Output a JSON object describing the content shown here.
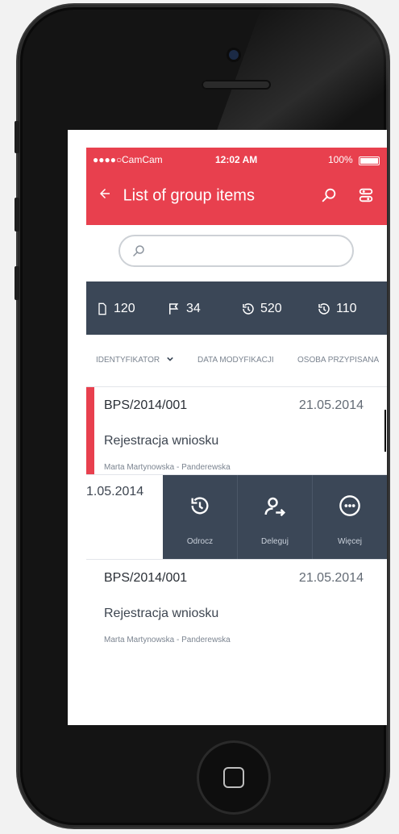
{
  "status": {
    "signal": "●●●●○",
    "carrier": "CamCam",
    "time": "12:02 AM",
    "battery": "100%"
  },
  "header": {
    "title": "List of group items",
    "back_icon": "arrow-left-icon",
    "search_icon": "search-icon",
    "filter_icon": "filter-icon"
  },
  "search": {
    "placeholder": ""
  },
  "stats": [
    {
      "icon": "document-icon",
      "value": "120"
    },
    {
      "icon": "flag-icon",
      "value": "34"
    },
    {
      "icon": "history-icon",
      "value": "520"
    },
    {
      "icon": "history-icon",
      "value": "110"
    }
  ],
  "sort": {
    "col1": "IDENTYFIKATOR",
    "col2": "DATA MODYFIKACJI",
    "col3": "OSOBA PRZYPISANA"
  },
  "items": [
    {
      "id": "BPS/2014/001",
      "date": "21.05.2014",
      "title": "Rejestracja wniosku",
      "owner": "Marta Martynowska - Panderewska"
    },
    {
      "id": "BPS/2014/001",
      "date": "21.05.2014",
      "title": "Rejestracja wniosku",
      "owner": "Marta Martynowska - Panderewska"
    }
  ],
  "swipe": {
    "visible_date": "1.05.2014",
    "actions": [
      {
        "label": "Odrocz",
        "icon": "history-icon"
      },
      {
        "label": "Deleguj",
        "icon": "delegate-user-icon"
      },
      {
        "label": "Więcej",
        "icon": "more-icon"
      }
    ]
  },
  "colors": {
    "primary": "#e8404e",
    "dark": "#3b4757"
  }
}
